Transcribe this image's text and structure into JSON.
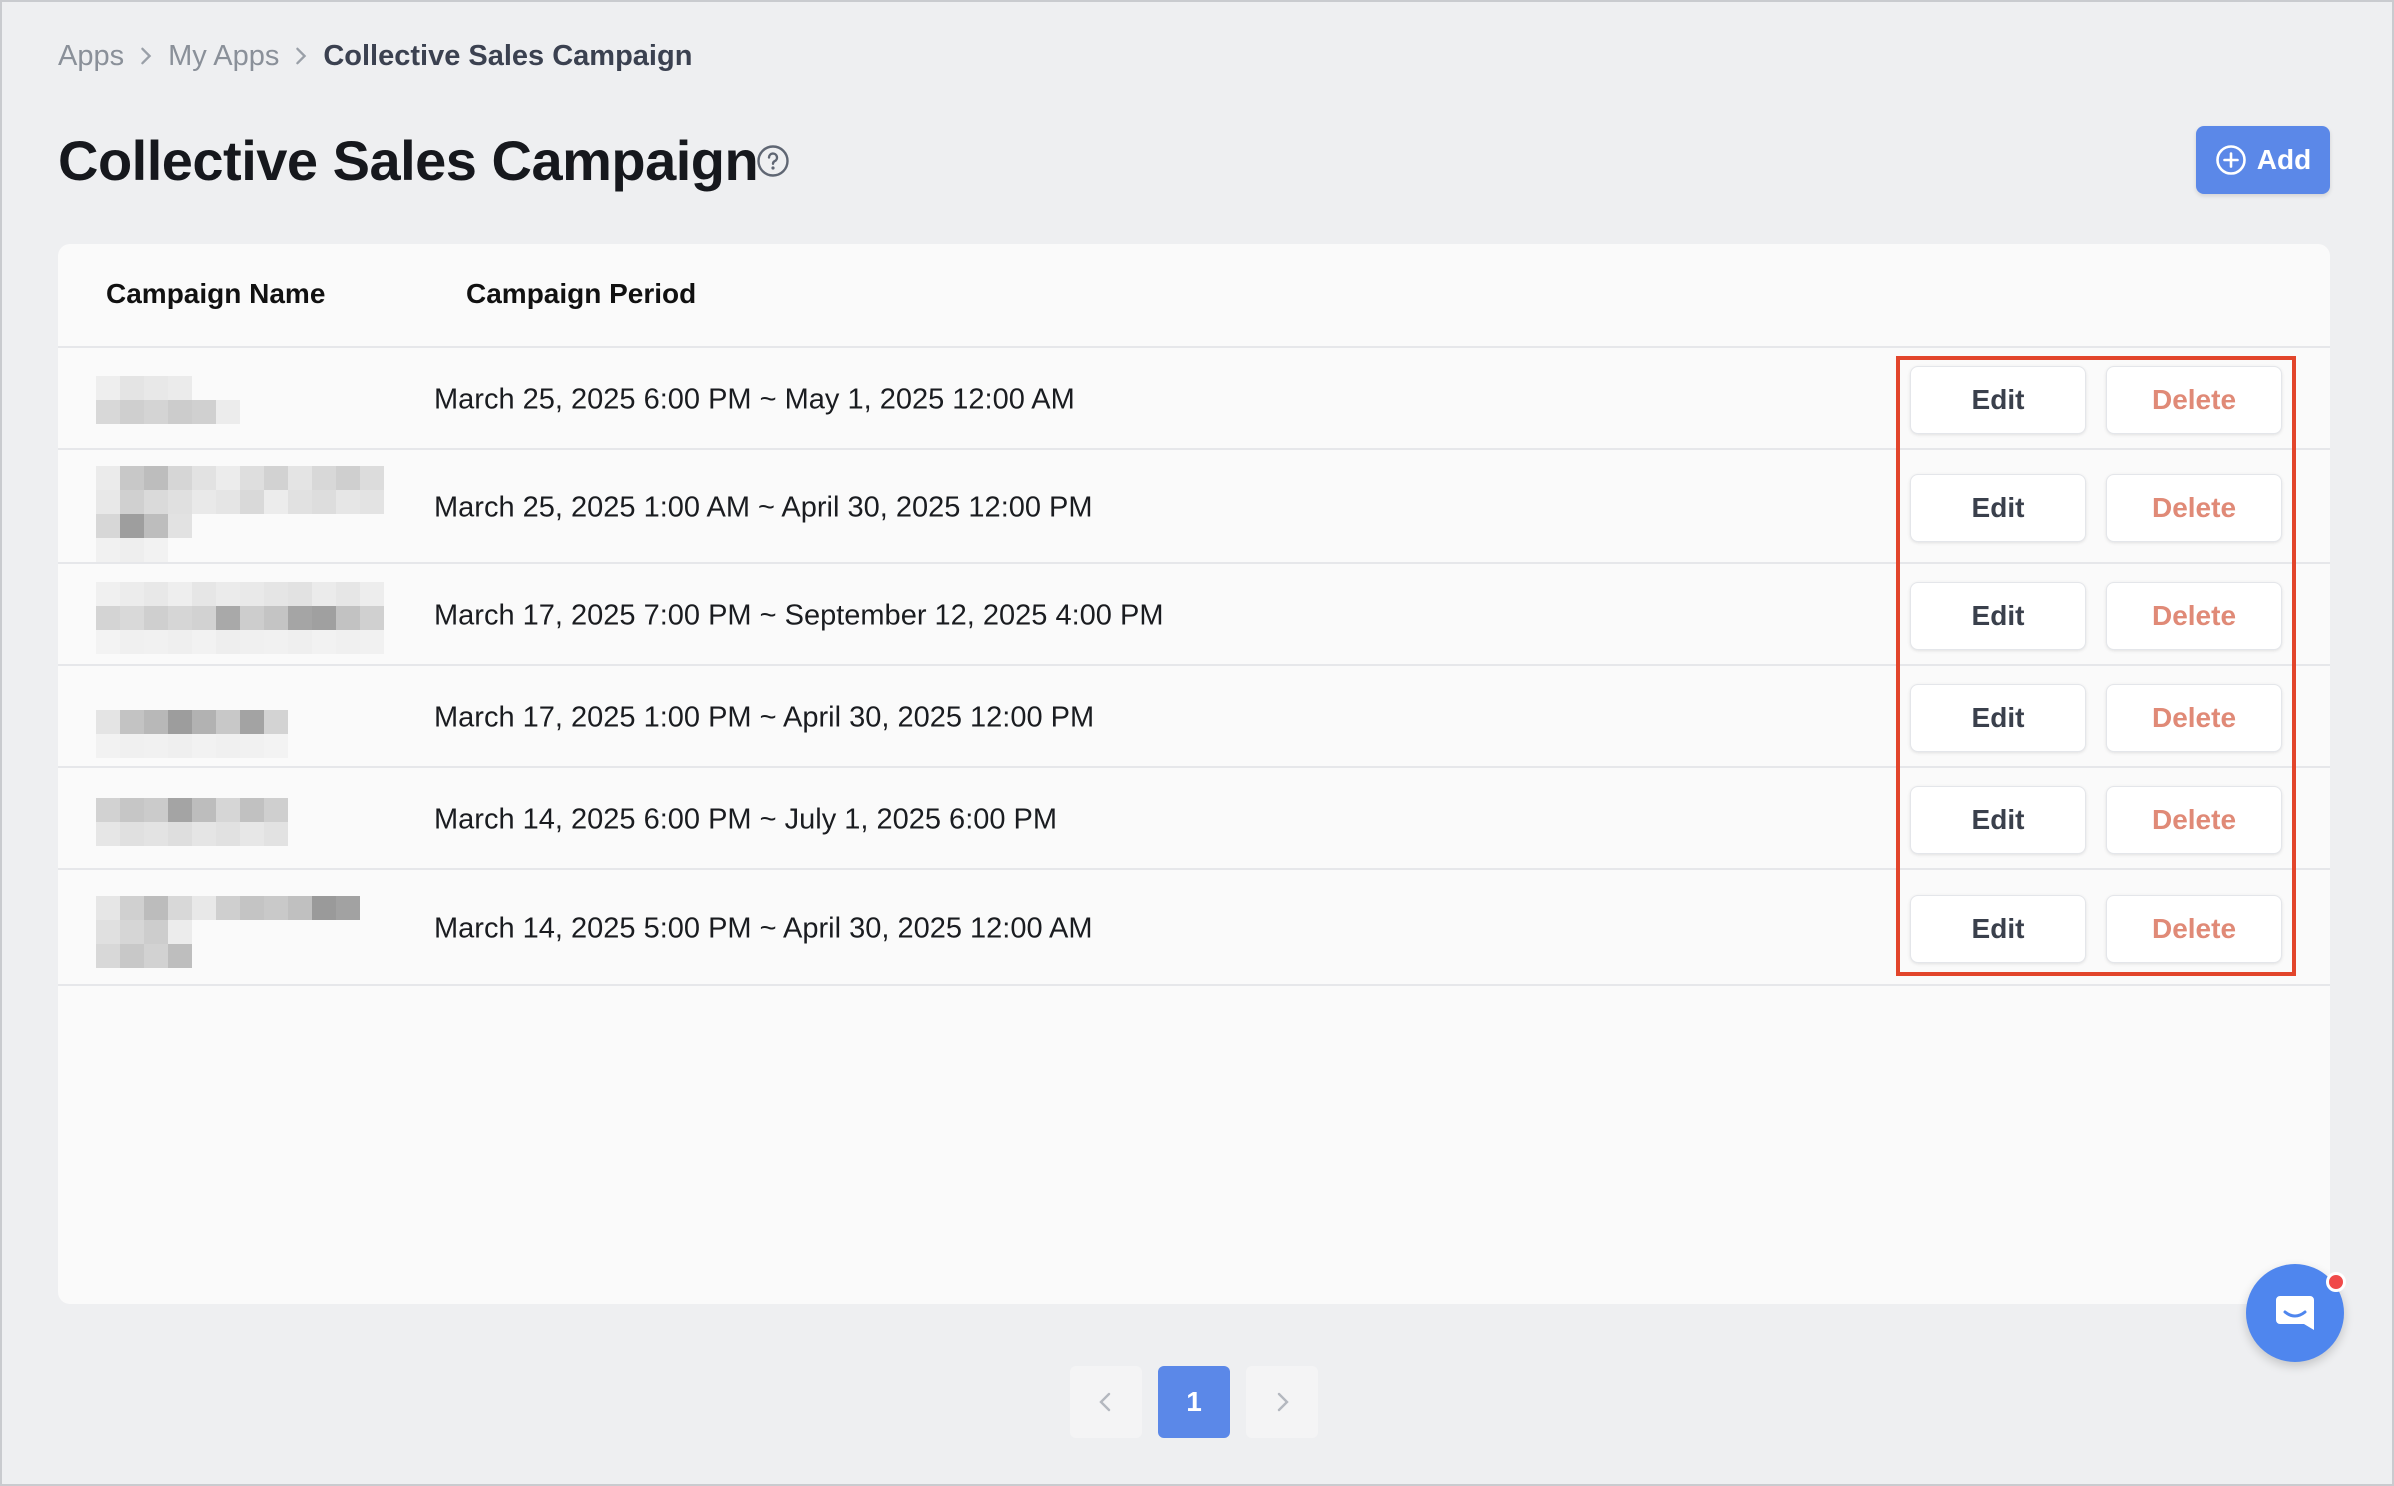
{
  "breadcrumb": {
    "items": [
      "Apps",
      "My Apps",
      "Collective Sales Campaign"
    ]
  },
  "page": {
    "title": "Collective Sales Campaign",
    "add_label": "Add"
  },
  "table": {
    "columns": [
      "Campaign Name",
      "Campaign Period"
    ],
    "rows": [
      {
        "period": "March 25, 2025 6:00 PM ~ May 1, 2025 12:00 AM",
        "edit_label": "Edit",
        "delete_label": "Delete"
      },
      {
        "period": "March 25, 2025 1:00 AM ~ April 30, 2025 12:00 PM",
        "edit_label": "Edit",
        "delete_label": "Delete"
      },
      {
        "period": "March 17, 2025 7:00 PM ~ September 12, 2025 4:00 PM",
        "edit_label": "Edit",
        "delete_label": "Delete"
      },
      {
        "period": "March 17, 2025 1:00 PM ~ April 30, 2025 12:00 PM",
        "edit_label": "Edit",
        "delete_label": "Delete"
      },
      {
        "period": "March 14, 2025 6:00 PM ~ July 1, 2025 6:00 PM",
        "edit_label": "Edit",
        "delete_label": "Delete"
      },
      {
        "period": "March 14, 2025 5:00 PM ~ April 30, 2025 12:00 AM",
        "edit_label": "Edit",
        "delete_label": "Delete"
      }
    ]
  },
  "pagination": {
    "current_page": "1"
  },
  "icons": {
    "breadcrumb_separator": "chevron-right-icon",
    "help": "question-circle-icon",
    "add": "plus-circle-icon",
    "prev": "chevron-left-icon",
    "next": "chevron-right-icon",
    "chat": "chat-icon"
  },
  "colors": {
    "primary": "#5b88e8",
    "delete_text": "#e08a77",
    "highlight": "#e2452b",
    "chat_badge": "#f04a4a"
  }
}
